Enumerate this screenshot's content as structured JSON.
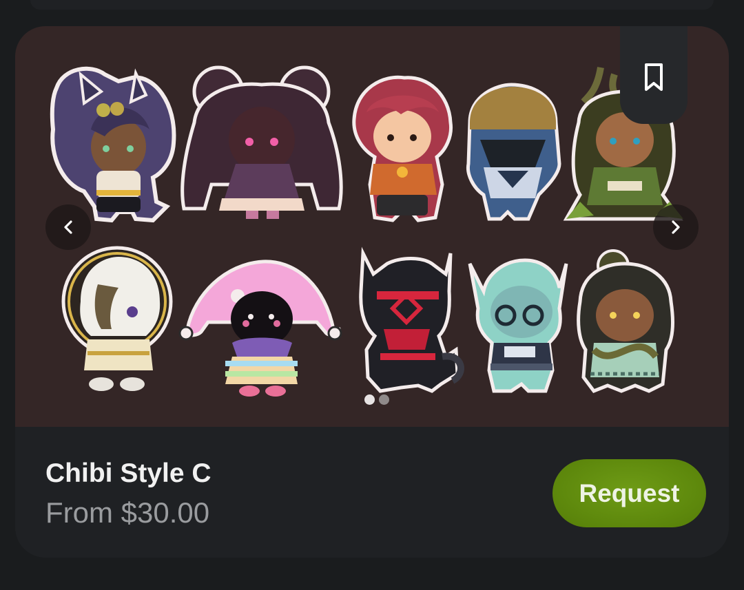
{
  "listing": {
    "title": "Chibi Style C",
    "price_text": "From $30.00",
    "request_label": "Request"
  },
  "gallery": {
    "image_count": 2,
    "current_index": 1,
    "prev_icon": "chevron-left-icon",
    "next_icon": "chevron-right-icon",
    "bookmark_icon": "bookmark-icon",
    "background_color": "#342626"
  },
  "colors": {
    "page_background": "#1a1c1e",
    "card_background": "#1f2124",
    "title": "#f1f1f1",
    "price": "#9a9c9f",
    "request_button": "#66920f",
    "request_text": "#eef3e4"
  }
}
